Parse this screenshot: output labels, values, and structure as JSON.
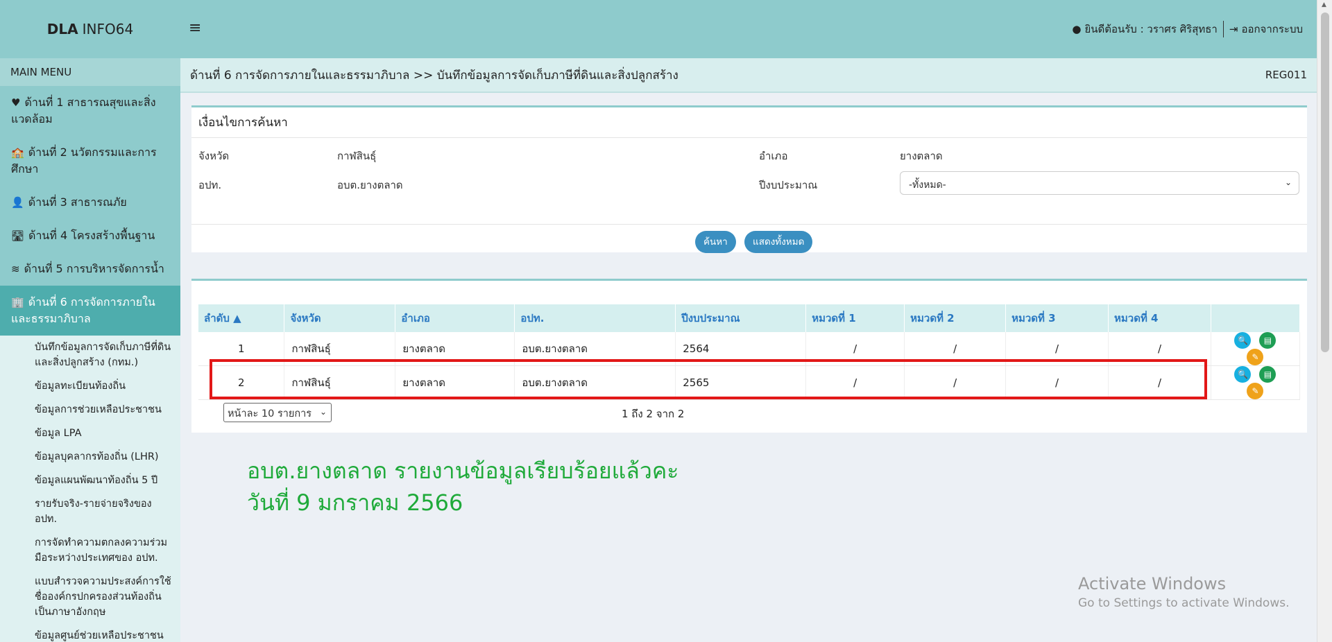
{
  "header": {
    "logo_bold": "DLA",
    "logo_light": "INFO64",
    "welcome": "ยินดีต้อนรับ : วราศร ศิริสุทธา",
    "logout": "ออกจากระบบ"
  },
  "sidebar": {
    "title": "MAIN MENU",
    "items": [
      {
        "label": "ด้านที่ 1 สาธารณสุขและสิ่งแวดล้อม",
        "icon": "♥"
      },
      {
        "label": "ด้านที่ 2 นวัตกรรมและการศึกษา",
        "icon": "🏫"
      },
      {
        "label": "ด้านที่ 3 สาธารณภัย",
        "icon": "👤"
      },
      {
        "label": "ด้านที่ 4 โครงสร้างพื้นฐาน",
        "icon": "🛣"
      },
      {
        "label": "ด้านที่ 5 การบริหารจัดการน้ำ",
        "icon": "≋"
      },
      {
        "label": "ด้านที่ 6 การจัดการภายในและธรรมาภิบาล",
        "icon": "🏢"
      }
    ],
    "subitems": [
      "บันทึกข้อมูลการจัดเก็บภาษีที่ดินและสิ่งปลูกสร้าง (กทม.)",
      "ข้อมูลทะเบียนท้องถิ่น",
      "ข้อมูลการช่วยเหลือประชาชน",
      "ข้อมูล LPA",
      "ข้อมูลบุคลากรท้องถิ่น (LHR)",
      "ข้อมูลแผนพัฒนาท้องถิ่น 5 ปี",
      "รายรับจริง-รายจ่ายจริงของ อปท.",
      "การจัดทำความตกลงความร่วมมือระหว่างประเทศของ อปท.",
      "แบบสำรวจความประสงค์การใช้ชื่อองค์กรปกครองส่วนท้องถิ่นเป็นภาษาอังกฤษ",
      "ข้อมูลศูนย์ช่วยเหลือประชาชน"
    ]
  },
  "breadcrumb": {
    "path": "ด้านที่ 6 การจัดการภายในและธรรมาภิบาล >>  บันทึกข้อมูลการจัดเก็บภาษีที่ดินและสิ่งปลูกสร้าง",
    "code": "REG011"
  },
  "search": {
    "title": "เงื่อนไขการค้นหา",
    "province_label": "จังหวัด",
    "province_value": "กาฬสินธุ์",
    "district_label": "อำเภอ",
    "district_value": "ยางตลาด",
    "org_label": "อปท.",
    "org_value": "อบต.ยางตลาด",
    "year_label": "ปีงบประมาณ",
    "year_selected": "-ทั้งหมด-",
    "search_btn": "ค้นหา",
    "show_all_btn": "แสดงทั้งหมด"
  },
  "table": {
    "headers": [
      "ลำดับ ▲",
      "จังหวัด",
      "อำเภอ",
      "อปท.",
      "ปีงบประมาณ",
      "หมวดที่ 1",
      "หมวดที่ 2",
      "หมวดที่ 3",
      "หมวดที่ 4",
      ""
    ],
    "rows": [
      [
        "1",
        "กาฬสินธุ์",
        "ยางตลาด",
        "อบต.ยางตลาด",
        "2564",
        "/",
        "/",
        "/",
        "/"
      ],
      [
        "2",
        "กาฬสินธุ์",
        "ยางตลาด",
        "อบต.ยางตลาด",
        "2565",
        "/",
        "/",
        "/",
        "/"
      ]
    ],
    "page_size": "หน้าละ 10 รายการ",
    "info": "1 ถึง 2 จาก 2"
  },
  "notice": {
    "line1": "อบต.ยางตลาด รายงานข้อมูลเรียบร้อยแล้วคะ",
    "line2": "วันที่ 9 มกราคม 2566"
  },
  "watermark": {
    "line1": "Activate Windows",
    "line2": "Go to Settings to activate Windows."
  },
  "colors": {
    "header_bg": "#8ecbcc",
    "active_menu": "#4eadad",
    "highlight": "#e21818",
    "notice_text": "#1faa3a"
  }
}
